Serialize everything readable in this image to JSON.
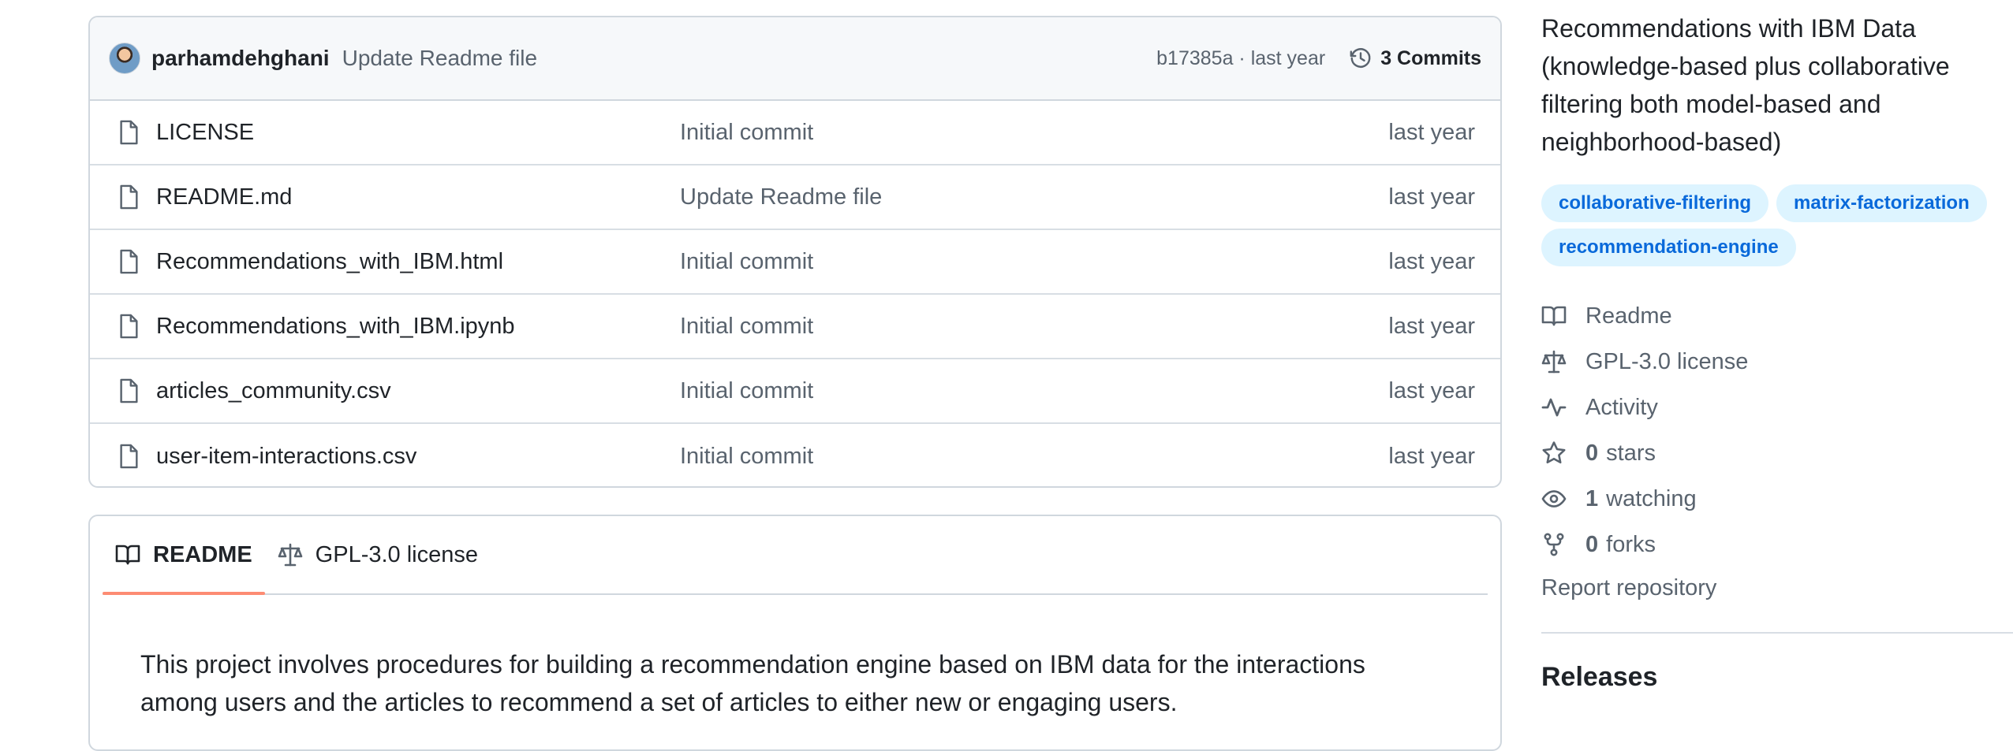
{
  "latest_commit": {
    "author": "parhamdehghani",
    "message": "Update Readme file",
    "hash_time": "b17385a · last year",
    "commits_label": "3 Commits"
  },
  "files": [
    {
      "name": "LICENSE",
      "message": "Initial commit",
      "date": "last year",
      "icon": "file-icon"
    },
    {
      "name": "README.md",
      "message": "Update Readme file",
      "date": "last year",
      "icon": "file-icon"
    },
    {
      "name": "Recommendations_with_IBM.html",
      "message": "Initial commit",
      "date": "last year",
      "icon": "file-icon"
    },
    {
      "name": "Recommendations_with_IBM.ipynb",
      "message": "Initial commit",
      "date": "last year",
      "icon": "file-icon"
    },
    {
      "name": "articles_community.csv",
      "message": "Initial commit",
      "date": "last year",
      "icon": "file-icon"
    },
    {
      "name": "user-item-interactions.csv",
      "message": "Initial commit",
      "date": "last year",
      "icon": "file-icon"
    }
  ],
  "readme": {
    "tabs": [
      {
        "label": "README",
        "icon": "book-icon",
        "active": true
      },
      {
        "label": "GPL-3.0 license",
        "icon": "law-icon",
        "active": false
      }
    ],
    "text": "This project involves procedures for building a recommendation engine based on IBM data for the interactions among users and the articles to recommend a set of articles to either new or engaging users."
  },
  "about": {
    "description": "Recommendations with IBM Data (knowledge-based plus collaborative filtering both model-based and neighborhood-based)",
    "topics": [
      "collaborative-filtering",
      "matrix-factorization",
      "recommendation-engine"
    ],
    "links": [
      {
        "icon": "book-icon",
        "count": "",
        "label": "Readme"
      },
      {
        "icon": "law-icon",
        "count": "",
        "label": "GPL-3.0 license"
      },
      {
        "icon": "pulse-icon",
        "count": "",
        "label": "Activity"
      },
      {
        "icon": "star-icon",
        "count": "0",
        "label": "stars"
      },
      {
        "icon": "eye-icon",
        "count": "1",
        "label": "watching"
      },
      {
        "icon": "fork-icon",
        "count": "0",
        "label": "forks"
      }
    ],
    "report_label": "Report repository",
    "releases_heading": "Releases"
  },
  "colors": {
    "link": "#0969da",
    "topic_bg": "#ddf4ff",
    "tab_underline": "#fd8c73",
    "muted": "#59636e"
  }
}
